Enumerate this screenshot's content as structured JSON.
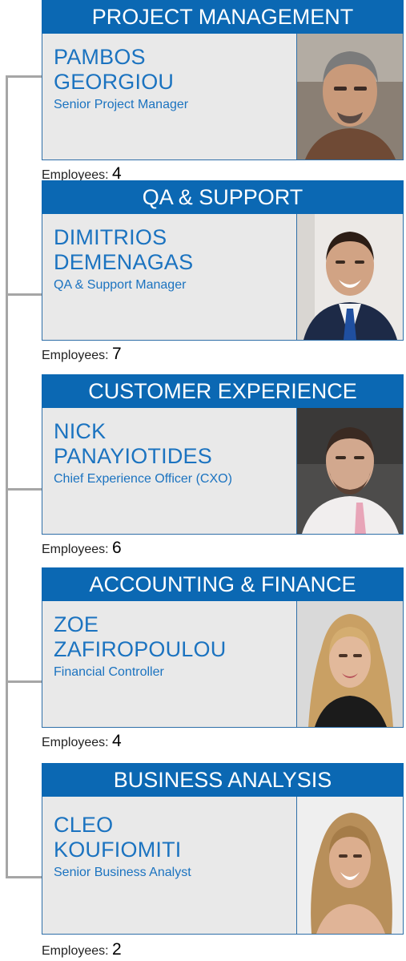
{
  "employees_label": "Employees:",
  "colors": {
    "header": "#0b68b3",
    "text": "#1b73c0",
    "panel": "#e9e9e9",
    "connector": "#a6a6a6"
  },
  "departments": [
    {
      "title": "PROJECT MANAGEMENT",
      "first_name": "PAMBOS",
      "last_name": "GEORGIOU",
      "role": "Senior Project Manager",
      "employees": "4",
      "photo": "man-grey-hair-portrait"
    },
    {
      "title": "QA & SUPPORT",
      "first_name": "DIMITRIOS",
      "last_name": "DEMENAGAS",
      "role": "QA & Support Manager",
      "employees": "7",
      "photo": "man-suit-portrait"
    },
    {
      "title": "CUSTOMER EXPERIENCE",
      "first_name": "NICK",
      "last_name": "PANAYIOTIDES",
      "role": "Chief Experience Officer (CXO)",
      "employees": "6",
      "photo": "man-beard-portrait"
    },
    {
      "title": "ACCOUNTING & FINANCE",
      "first_name": "ZOE",
      "last_name": "ZAFIROPOULOU",
      "role": "Financial Controller",
      "employees": "4",
      "photo": "woman-blonde-portrait"
    },
    {
      "title": "BUSINESS ANALYSIS",
      "first_name": "CLEO",
      "last_name": "KOUFIOMITI",
      "role": "Senior Business Analyst",
      "employees": "2",
      "photo": "woman-curly-hair-portrait"
    }
  ]
}
